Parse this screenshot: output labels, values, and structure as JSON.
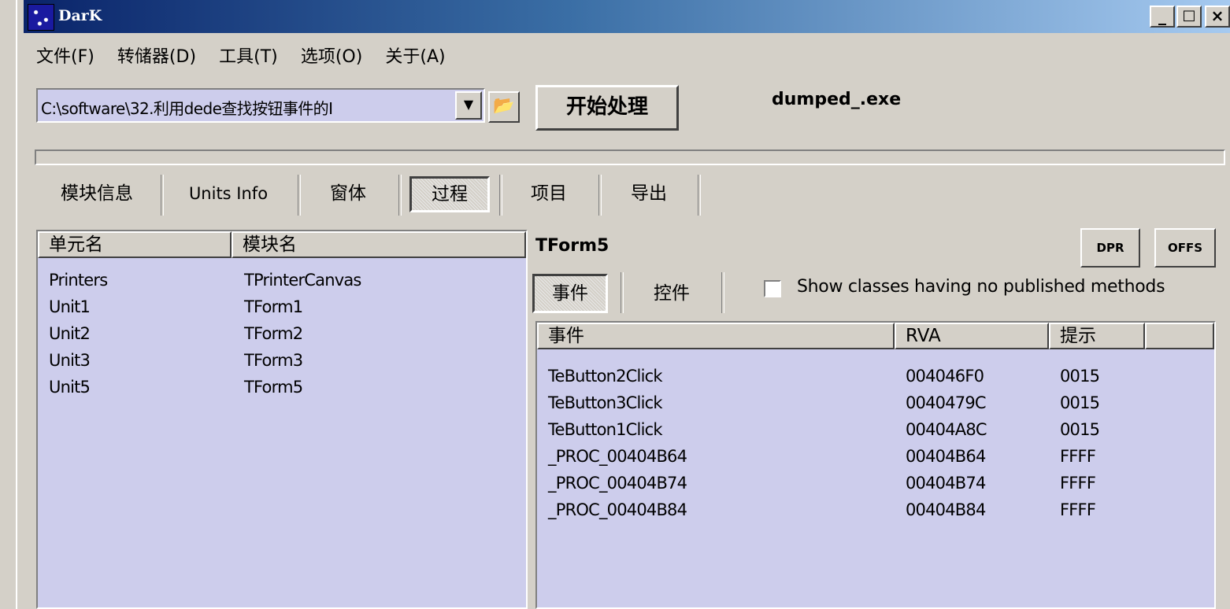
{
  "window": {
    "title": "DarK",
    "minimize": "_",
    "maximize": "□",
    "close": "×"
  },
  "menu": [
    "文件(F)",
    "转储器(D)",
    "工具(T)",
    "选项(O)",
    "关于(A)"
  ],
  "toolbar": {
    "path": "C:\\software\\32.利用dede查找按钮事件的I",
    "start_label": "开始处理",
    "filename": "dumped_.exe"
  },
  "progress": {
    "value": 0
  },
  "tabs": [
    "模块信息",
    "Units Info",
    "窗体",
    "过程",
    "项目",
    "导出"
  ],
  "active_tab": "过程",
  "units_list": {
    "columns": [
      "单元名",
      "模块名"
    ],
    "rows": [
      [
        "Printers",
        "TPrinterCanvas"
      ],
      [
        "Unit1",
        "TForm1"
      ],
      [
        "Unit2",
        "TForm2"
      ],
      [
        "Unit3",
        "TForm3"
      ],
      [
        "Unit5",
        "TForm5"
      ]
    ]
  },
  "right_panel": {
    "form_name": "TForm5",
    "dpr_label": "DPR",
    "offs_label": "OFFS",
    "subtabs": [
      "事件",
      "控件"
    ],
    "active_subtab": "事件",
    "checkbox_label": "Show classes having no published methods",
    "checkbox_checked": false,
    "events": {
      "columns": [
        "事件",
        "RVA",
        "提示"
      ],
      "rows": [
        [
          "TeButton2Click",
          "004046F0",
          "0015"
        ],
        [
          "TeButton3Click",
          "0040479C",
          "0015"
        ],
        [
          "TeButton1Click",
          "00404A8C",
          "0015"
        ],
        [
          "_PROC_00404B64",
          "00404B64",
          "FFFF"
        ],
        [
          "_PROC_00404B74",
          "00404B74",
          "FFFF"
        ],
        [
          "_PROC_00404B84",
          "00404B84",
          "FFFF"
        ]
      ]
    }
  }
}
